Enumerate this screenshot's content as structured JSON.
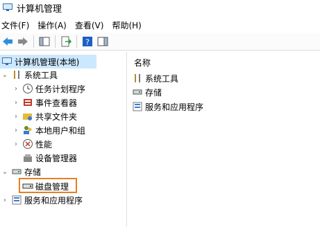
{
  "window": {
    "title": "计算机管理"
  },
  "menu": [
    {
      "label": "文件(F)"
    },
    {
      "label": "操作(A)"
    },
    {
      "label": "查看(V)"
    },
    {
      "label": "帮助(H)"
    }
  ],
  "tree": {
    "root": "计算机管理(本地)",
    "system_tools": "系统工具",
    "task_scheduler": "任务计划程序",
    "event_viewer": "事件查看器",
    "shared_folders": "共享文件夹",
    "local_users": "本地用户和组",
    "performance": "性能",
    "device_manager": "设备管理器",
    "storage": "存储",
    "disk_management": "磁盘管理",
    "services_apps": "服务和应用程序"
  },
  "content": {
    "column_header": "名称",
    "items": [
      {
        "label": "系统工具",
        "icon": "tools-icon"
      },
      {
        "label": "存储",
        "icon": "storage-icon"
      },
      {
        "label": "服务和应用程序",
        "icon": "services-icon"
      }
    ]
  },
  "colors": {
    "selection": "#cce8ff",
    "highlight": "#e67e22",
    "help_blue": "#1e5fc6"
  }
}
